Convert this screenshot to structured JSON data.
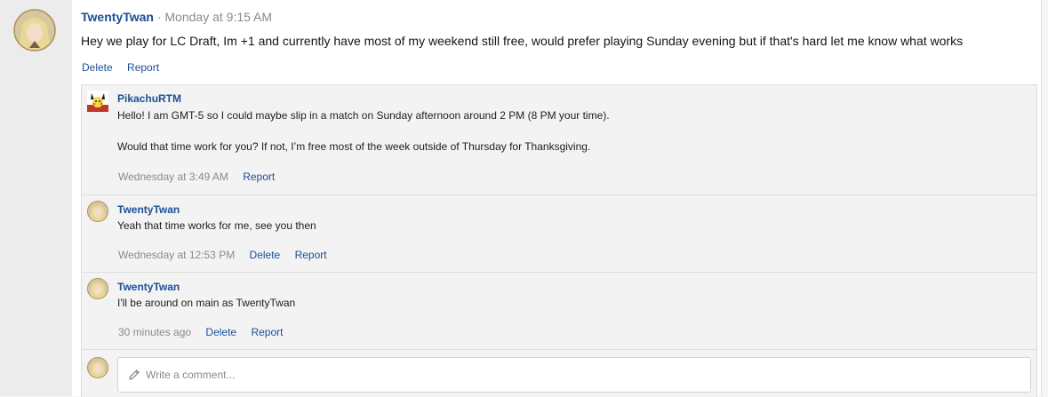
{
  "post": {
    "author": "TwentyTwan",
    "separator": "·",
    "timestamp": "Monday at 9:15 AM",
    "body": "Hey we play for LC Draft, Im +1 and currently have most of my weekend still free, would prefer playing Sunday evening but if that's hard let me know what works",
    "actions": {
      "delete": "Delete",
      "report": "Report"
    }
  },
  "comments": [
    {
      "author": "PikachuRTM",
      "lines": [
        "Hello! I am GMT-5 so I could maybe slip in a match on Sunday afternoon around 2 PM (8 PM your time).",
        "",
        "Would that time work for you? If not, I’m free most of the week outside of Thursday for Thanksgiving."
      ],
      "time": "Wednesday at 3:49 AM",
      "report": "Report"
    },
    {
      "author": "TwentyTwan",
      "lines": [
        "Yeah that time works for me, see you then"
      ],
      "time": "Wednesday at 12:53 PM",
      "delete": "Delete",
      "report": "Report"
    },
    {
      "author": "TwentyTwan",
      "lines": [
        "I'll be around on main as TwentyTwan"
      ],
      "time": "30 minutes ago",
      "delete": "Delete",
      "report": "Report"
    }
  ],
  "write_comment": {
    "placeholder": "Write a comment..."
  },
  "colors": {
    "link": "#1b4f95",
    "muted": "#8a8a8a",
    "panel": "#f3f3f3"
  },
  "icons": {
    "avatar_main": "blonde-character-avatar",
    "avatar_other": "pikachu-avatar",
    "write": "pencil-icon"
  }
}
